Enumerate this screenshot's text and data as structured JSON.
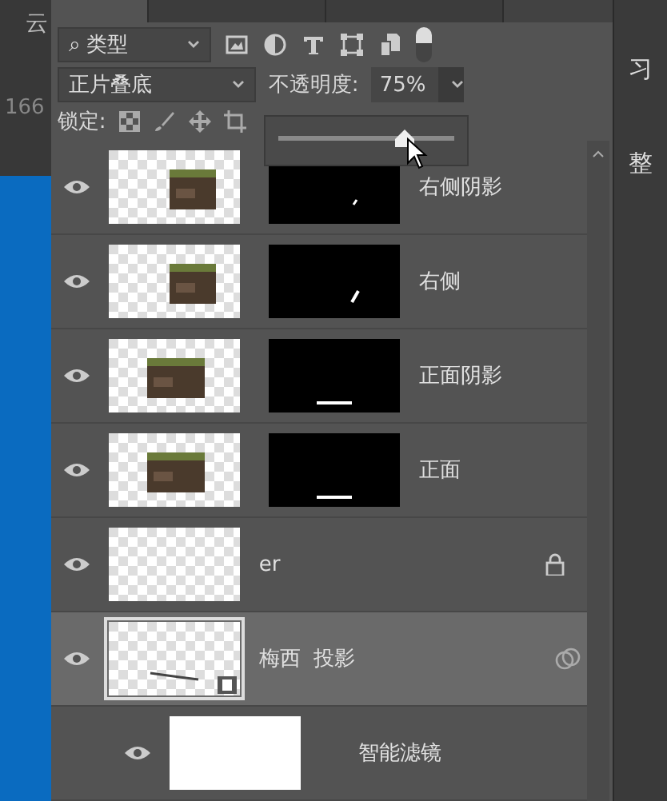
{
  "left_strip": {
    "glyph": "云",
    "number": "166"
  },
  "right_strip": {
    "glyph_top": "习",
    "glyph_bottom": "整"
  },
  "tabs": [
    {
      "selected": true
    },
    {
      "selected": false
    },
    {
      "selected": false
    }
  ],
  "filter": {
    "label": "类型",
    "search_icon": "⌕",
    "toggle_on": true
  },
  "blend_mode": "正片叠底",
  "opacity": {
    "label": "不透明度:",
    "value": "75%",
    "level": 0.72
  },
  "lock": {
    "label": "锁定:"
  },
  "layers": [
    {
      "name": "右侧阴影",
      "visible": true,
      "selected": false,
      "mask": true,
      "locked": false,
      "smart": false
    },
    {
      "name": "右侧",
      "visible": true,
      "selected": false,
      "mask": true,
      "locked": false,
      "smart": false
    },
    {
      "name": "正面阴影",
      "visible": true,
      "selected": false,
      "mask": true,
      "locked": false,
      "smart": false
    },
    {
      "name": "正面",
      "visible": true,
      "selected": false,
      "mask": true,
      "locked": false,
      "smart": false
    },
    {
      "name": "er",
      "visible": true,
      "selected": false,
      "mask": false,
      "locked": true,
      "smart": false
    },
    {
      "name": "梅西  投影",
      "visible": true,
      "selected": true,
      "mask": false,
      "locked": false,
      "smart": true,
      "children": [
        {
          "name": "智能滤镜",
          "visible": true,
          "selected": false,
          "mask": false,
          "locked": false,
          "smart": false
        }
      ]
    }
  ]
}
